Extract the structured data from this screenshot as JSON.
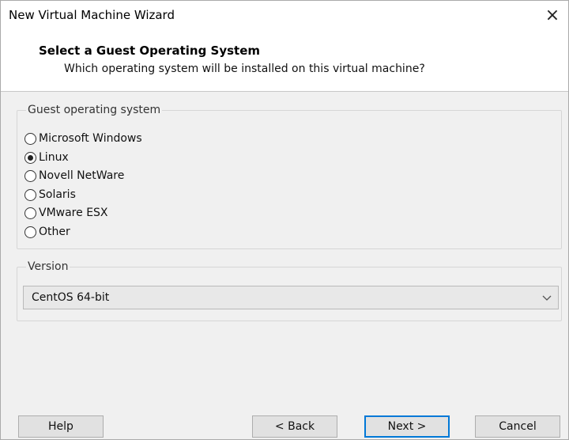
{
  "window": {
    "title": "New Virtual Machine Wizard",
    "close_glyph": "×"
  },
  "header": {
    "title": "Select a Guest Operating System",
    "subtitle": "Which operating system will be installed on this virtual machine?"
  },
  "guest_os": {
    "legend": "Guest operating system",
    "options": [
      {
        "label": "Microsoft Windows",
        "selected": false
      },
      {
        "label": "Linux",
        "selected": true
      },
      {
        "label": "Novell NetWare",
        "selected": false
      },
      {
        "label": "Solaris",
        "selected": false
      },
      {
        "label": "VMware ESX",
        "selected": false
      },
      {
        "label": "Other",
        "selected": false
      }
    ]
  },
  "version": {
    "legend": "Version",
    "selected": "CentOS 64-bit"
  },
  "buttons": {
    "help": "Help",
    "back": "< Back",
    "next": "Next >",
    "cancel": "Cancel"
  },
  "colors": {
    "accent": "#0078d7",
    "dialog_bg": "#f0f0f0"
  }
}
